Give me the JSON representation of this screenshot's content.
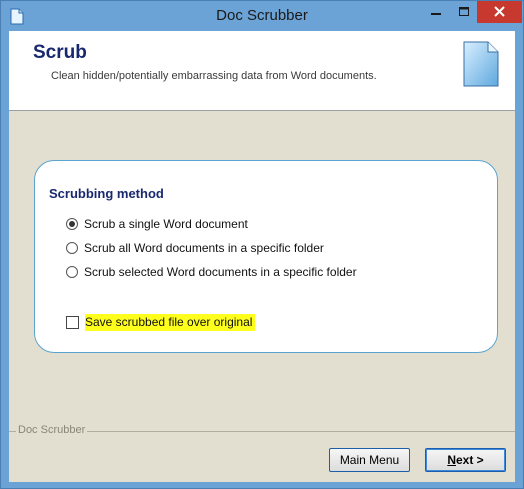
{
  "window": {
    "title": "Doc Scrubber",
    "accent_color": "#6ba3d6",
    "close_color": "#c7392e",
    "controls": [
      "minimize-icon",
      "maximize-icon",
      "close-icon"
    ]
  },
  "header": {
    "title": "Scrub",
    "subtitle": "Clean hidden/potentially embarrassing data from Word documents.",
    "icon": "document-icon"
  },
  "method": {
    "title": "Scrubbing method",
    "options": [
      {
        "label": "Scrub a single Word document",
        "selected": true
      },
      {
        "label": "Scrub all Word documents in a specific folder",
        "selected": false
      },
      {
        "label": "Scrub selected Word documents in a specific folder",
        "selected": false
      }
    ],
    "save_over": {
      "label": "Save scrubbed file over original",
      "checked": false,
      "highlight_color": "#ffff1e"
    }
  },
  "footer": {
    "label": "Doc Scrubber",
    "main_menu_label": "Main Menu",
    "next_label": "Next >"
  }
}
